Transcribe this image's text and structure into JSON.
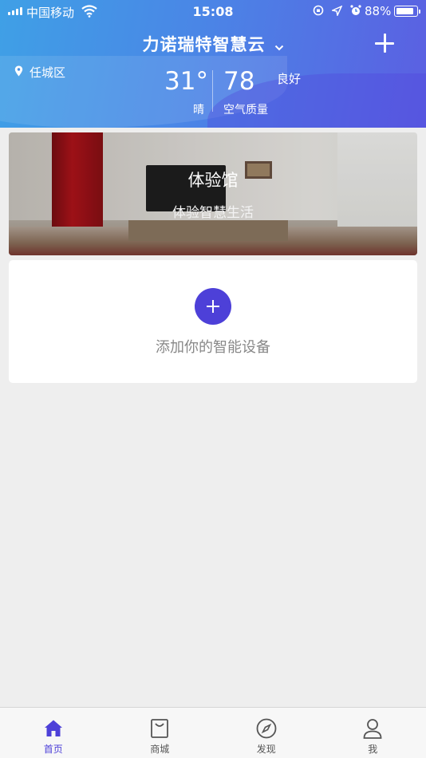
{
  "status_bar": {
    "carrier": "中国移动",
    "time": "15:08",
    "battery_percent": "88%",
    "battery_level": 0.88
  },
  "header": {
    "title": "力诺瑞特智慧云",
    "location": "任城区",
    "temperature": "31°",
    "weather": "晴",
    "aqi_value": "78",
    "aqi_level": "良好",
    "aqi_label": "空气质量"
  },
  "banner": {
    "title": "体验馆",
    "subtitle": "体验智慧生活"
  },
  "add_device": {
    "label": "添加你的智能设备"
  },
  "tabs": [
    {
      "label": "首页",
      "icon": "home-icon",
      "active": true
    },
    {
      "label": "商城",
      "icon": "shop-bag-icon",
      "active": false
    },
    {
      "label": "发现",
      "icon": "compass-icon",
      "active": false
    },
    {
      "label": "我",
      "icon": "user-icon",
      "active": false
    }
  ],
  "colors": {
    "accent": "#4d40d8",
    "header_start": "#3fa0e6",
    "header_end": "#5b5fe2"
  }
}
